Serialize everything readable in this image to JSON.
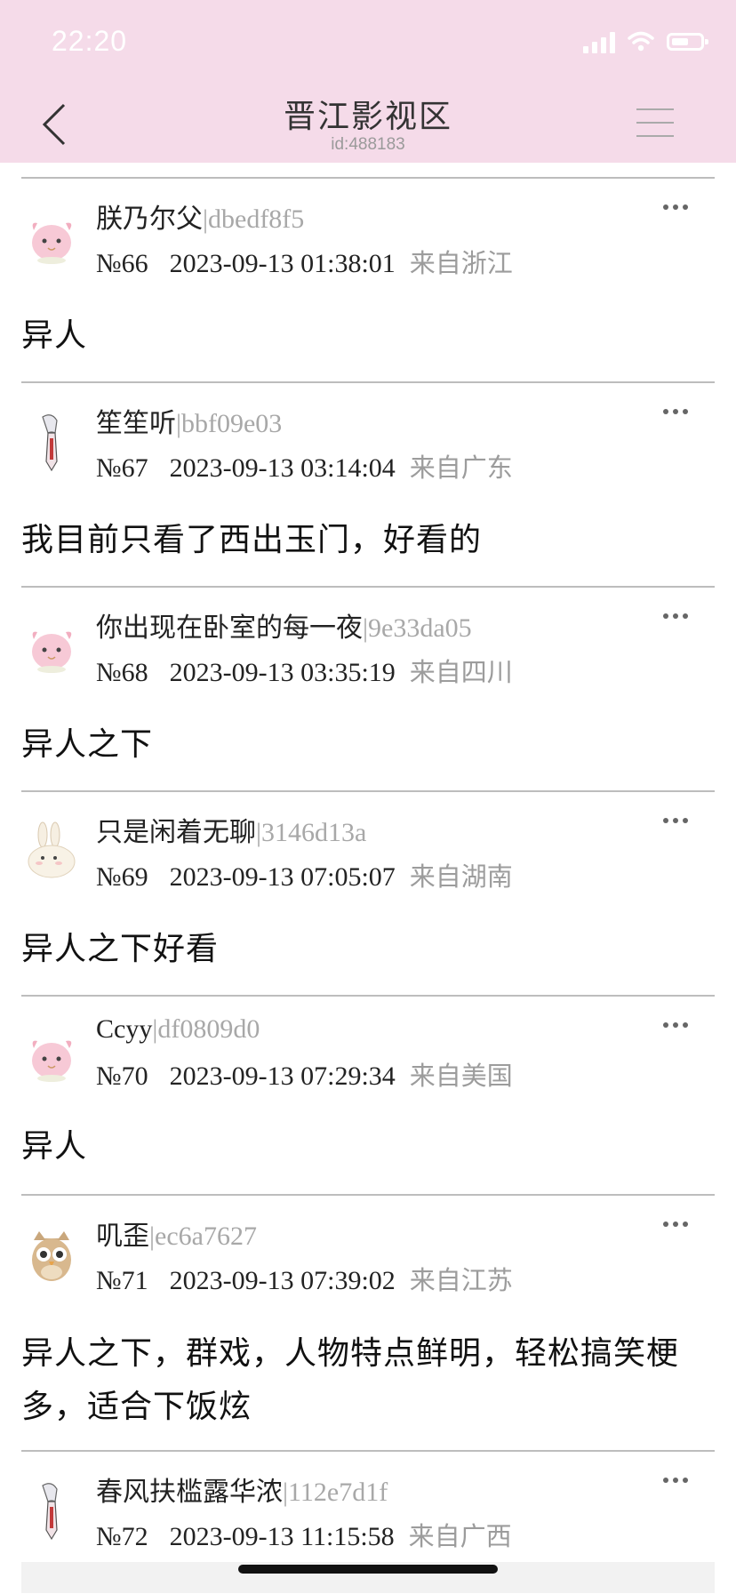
{
  "status": {
    "time": "22:20"
  },
  "header": {
    "title": "晋江影视区",
    "subtitle": "id:488183"
  },
  "posts": [
    {
      "username": "朕乃尔父",
      "uid": "|dbedf8f5",
      "floor": "№66",
      "time": "2023-09-13 01:38:01",
      "location": "来自浙江",
      "content": "异人",
      "avatar": "pink-creature-avatar"
    },
    {
      "username": "笙笙听",
      "uid": "|bbf09e03",
      "floor": "№67",
      "time": "2023-09-13 03:14:04",
      "location": "来自广东",
      "content": "我目前只看了西出玉门，好看的",
      "avatar": "sword-character-avatar"
    },
    {
      "username": "你出现在卧室的每一夜",
      "uid": "|9e33da05",
      "floor": "№68",
      "time": "2023-09-13 03:35:19",
      "location": "来自四川",
      "content": "异人之下",
      "avatar": "pink-creature-avatar"
    },
    {
      "username": "只是闲着无聊",
      "uid": "|3146d13a",
      "floor": "№69",
      "time": "2023-09-13 07:05:07",
      "location": "来自湖南",
      "content": "异人之下好看",
      "avatar": "rabbit-avatar"
    },
    {
      "username": "Ccyy",
      "uid": "|df0809d0",
      "floor": "№70",
      "time": "2023-09-13 07:29:34",
      "location": "来自美国",
      "content": "异人",
      "avatar": "pink-creature-avatar"
    },
    {
      "username": "叽歪",
      "uid": "|ec6a7627",
      "floor": "№71",
      "time": "2023-09-13 07:39:02",
      "location": "来自江苏",
      "content": "异人之下，群戏，人物特点鲜明，轻松搞笑梗多，适合下饭炫",
      "avatar": "owl-avatar"
    },
    {
      "username": "春风扶槛露华浓",
      "uid": "|112e7d1f",
      "floor": "№72",
      "time": "2023-09-13 11:15:58",
      "location": "来自广西",
      "content": "",
      "avatar": "sword-character-avatar"
    }
  ]
}
